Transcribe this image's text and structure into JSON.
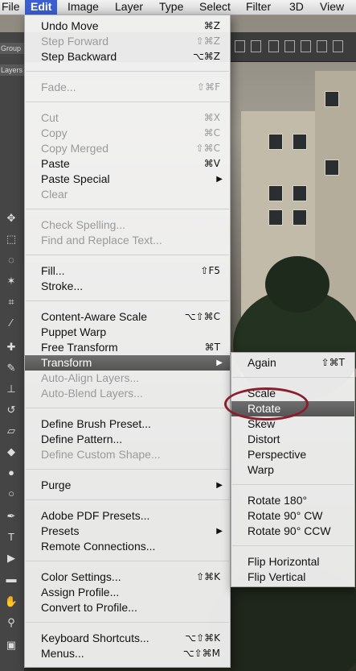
{
  "menubar": {
    "items": [
      {
        "label": "File",
        "active": false
      },
      {
        "label": "Edit",
        "active": true
      },
      {
        "label": "Image",
        "active": false
      },
      {
        "label": "Layer",
        "active": false
      },
      {
        "label": "Type",
        "active": false
      },
      {
        "label": "Select",
        "active": false
      },
      {
        "label": "Filter",
        "active": false
      },
      {
        "label": "3D",
        "active": false
      },
      {
        "label": "View",
        "active": false
      }
    ]
  },
  "side_tabs": {
    "group": "Group",
    "layers": "Layers"
  },
  "edit_menu": {
    "items": [
      {
        "label": "Undo Move",
        "shortcut": "⌘Z",
        "enabled": true
      },
      {
        "label": "Step Forward",
        "shortcut": "⇧⌘Z",
        "enabled": false
      },
      {
        "label": "Step Backward",
        "shortcut": "⌥⌘Z",
        "enabled": true
      },
      {
        "label": "Fade...",
        "shortcut": "⇧⌘F",
        "enabled": false
      },
      {
        "label": "Cut",
        "shortcut": "⌘X",
        "enabled": false
      },
      {
        "label": "Copy",
        "shortcut": "⌘C",
        "enabled": false
      },
      {
        "label": "Copy Merged",
        "shortcut": "⇧⌘C",
        "enabled": false
      },
      {
        "label": "Paste",
        "shortcut": "⌘V",
        "enabled": true
      },
      {
        "label": "Paste Special",
        "shortcut": "",
        "enabled": true,
        "submenu": true
      },
      {
        "label": "Clear",
        "shortcut": "",
        "enabled": false
      },
      {
        "label": "Check Spelling...",
        "shortcut": "",
        "enabled": false
      },
      {
        "label": "Find and Replace Text...",
        "shortcut": "",
        "enabled": false
      },
      {
        "label": "Fill...",
        "shortcut": "⇧F5",
        "enabled": true
      },
      {
        "label": "Stroke...",
        "shortcut": "",
        "enabled": true
      },
      {
        "label": "Content-Aware Scale",
        "shortcut": "⌥⇧⌘C",
        "enabled": true
      },
      {
        "label": "Puppet Warp",
        "shortcut": "",
        "enabled": true
      },
      {
        "label": "Free Transform",
        "shortcut": "⌘T",
        "enabled": true
      },
      {
        "label": "Transform",
        "shortcut": "",
        "enabled": true,
        "submenu": true,
        "highlighted": true
      },
      {
        "label": "Auto-Align Layers...",
        "shortcut": "",
        "enabled": false
      },
      {
        "label": "Auto-Blend Layers...",
        "shortcut": "",
        "enabled": false
      },
      {
        "label": "Define Brush Preset...",
        "shortcut": "",
        "enabled": true
      },
      {
        "label": "Define Pattern...",
        "shortcut": "",
        "enabled": true
      },
      {
        "label": "Define Custom Shape...",
        "shortcut": "",
        "enabled": false
      },
      {
        "label": "Purge",
        "shortcut": "",
        "enabled": true,
        "submenu": true
      },
      {
        "label": "Adobe PDF Presets...",
        "shortcut": "",
        "enabled": true
      },
      {
        "label": "Presets",
        "shortcut": "",
        "enabled": true,
        "submenu": true
      },
      {
        "label": "Remote Connections...",
        "shortcut": "",
        "enabled": true
      },
      {
        "label": "Color Settings...",
        "shortcut": "⇧⌘K",
        "enabled": true
      },
      {
        "label": "Assign Profile...",
        "shortcut": "",
        "enabled": true
      },
      {
        "label": "Convert to Profile...",
        "shortcut": "",
        "enabled": true
      },
      {
        "label": "Keyboard Shortcuts...",
        "shortcut": "⌥⇧⌘K",
        "enabled": true
      },
      {
        "label": "Menus...",
        "shortcut": "⌥⇧⌘M",
        "enabled": true
      }
    ]
  },
  "transform_submenu": {
    "items": [
      {
        "label": "Again",
        "shortcut": "⇧⌘T",
        "enabled": true
      },
      {
        "label": "Scale",
        "shortcut": "",
        "enabled": true
      },
      {
        "label": "Rotate",
        "shortcut": "",
        "enabled": true,
        "highlighted": true
      },
      {
        "label": "Skew",
        "shortcut": "",
        "enabled": true
      },
      {
        "label": "Distort",
        "shortcut": "",
        "enabled": true
      },
      {
        "label": "Perspective",
        "shortcut": "",
        "enabled": true
      },
      {
        "label": "Warp",
        "shortcut": "",
        "enabled": true
      },
      {
        "label": "Rotate 180°",
        "shortcut": "",
        "enabled": true
      },
      {
        "label": "Rotate 90° CW",
        "shortcut": "",
        "enabled": true
      },
      {
        "label": "Rotate 90° CCW",
        "shortcut": "",
        "enabled": true
      },
      {
        "label": "Flip Horizontal",
        "shortcut": "",
        "enabled": true
      },
      {
        "label": "Flip Vertical",
        "shortcut": "",
        "enabled": true
      }
    ]
  },
  "annotation": {
    "color": "#8b1e2c",
    "target": "Rotate"
  }
}
